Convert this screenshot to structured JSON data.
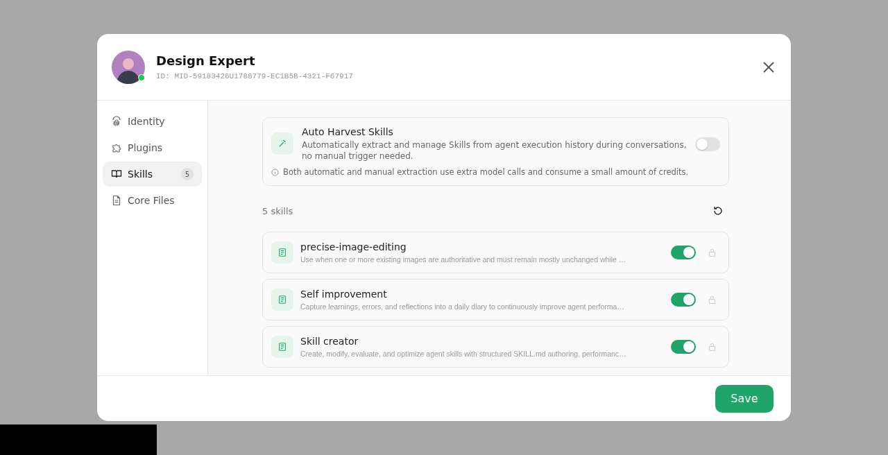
{
  "dialog": {
    "title": "Design Expert",
    "id_text": "ID: MID-59183426U1788779-EC1B5B-4321-F67917",
    "online": true
  },
  "sidebar": {
    "items": [
      {
        "label": "Identity",
        "selected": false
      },
      {
        "label": "Plugins",
        "selected": false
      },
      {
        "label": "Skills",
        "selected": true,
        "badge": "5"
      },
      {
        "label": "Core Files",
        "selected": false
      }
    ]
  },
  "auto_harvest": {
    "title": "Auto Harvest Skills",
    "description": "Automatically extract and manage Skills from agent execution history during conversations, no manual trigger needed.",
    "on": false,
    "note": "Both automatic and manual extraction use extra model calls and consume a small amount of credits."
  },
  "skills_count": "5 skills",
  "skills": [
    {
      "name": "precise-image-editing",
      "description": "Use when one or more existing images are authoritative and must remain mostly unchanged while …",
      "on": true
    },
    {
      "name": "Self improvement",
      "description": "Capture learnings, errors, and reflections into a daily diary to continuously improve agent performa…",
      "on": true
    },
    {
      "name": "Skill creator",
      "description": "Create, modify, evaluate, and optimize agent skills with structured SKILL.md authoring, performanc…",
      "on": true
    }
  ],
  "footer": {
    "save_label": "Save"
  }
}
